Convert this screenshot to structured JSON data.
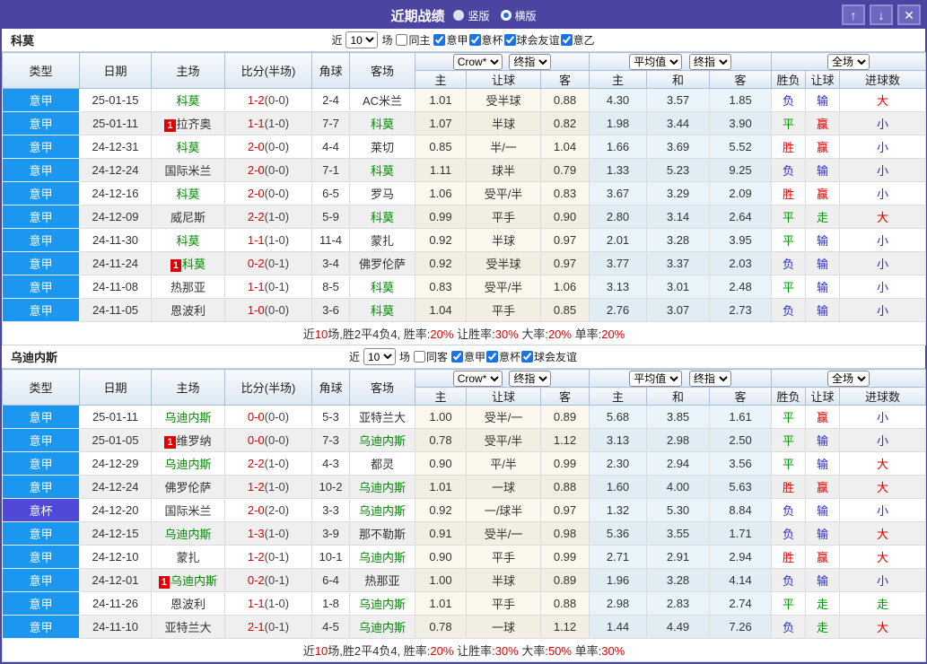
{
  "titlebar": {
    "title": "近期战绩",
    "radios": [
      {
        "label": "竖版",
        "selected": false
      },
      {
        "label": "横版",
        "selected": true
      }
    ],
    "up_icon": "↑",
    "down_icon": "↓",
    "close_icon": "✕"
  },
  "table_head": {
    "type": "类型",
    "date": "日期",
    "home": "主场",
    "score": "比分(半场)",
    "corner": "角球",
    "away": "客场",
    "odds_sub": [
      "主",
      "让球",
      "客"
    ],
    "avg_sub": [
      "主",
      "和",
      "客"
    ],
    "full_sub": [
      "胜负",
      "让球",
      "进球数"
    ]
  },
  "sections": [
    {
      "team": "科莫",
      "filter": {
        "prefix": "近",
        "count": "10",
        "suffix": "场",
        "same": "同主",
        "same_checked": false,
        "leagues": [
          "意甲",
          "意杯",
          "球会友谊",
          "意乙"
        ]
      },
      "selects": {
        "odds_src": "Crow*",
        "odds_kind": "终指",
        "avg_src": "平均值",
        "avg_kind": "终指",
        "scope": "全场"
      },
      "rows": [
        {
          "type": "意甲",
          "cup": false,
          "date": "25-01-15",
          "home": "科莫",
          "home_focus": true,
          "badge": null,
          "score": "1-2",
          "half": "(0-0)",
          "corner": "2-4",
          "away": "AC米兰",
          "away_focus": false,
          "odds": [
            "1.01",
            "受半球",
            "0.88"
          ],
          "avg": [
            "4.30",
            "3.57",
            "1.85"
          ],
          "result": [
            "负",
            "输",
            "大"
          ]
        },
        {
          "type": "意甲",
          "cup": false,
          "date": "25-01-11",
          "home": "拉齐奥",
          "home_focus": false,
          "badge": "1",
          "score": "1-1",
          "half": "(1-0)",
          "corner": "7-7",
          "away": "科莫",
          "away_focus": true,
          "odds": [
            "1.07",
            "半球",
            "0.82"
          ],
          "avg": [
            "1.98",
            "3.44",
            "3.90"
          ],
          "result": [
            "平",
            "赢",
            "小"
          ]
        },
        {
          "type": "意甲",
          "cup": false,
          "date": "24-12-31",
          "home": "科莫",
          "home_focus": true,
          "badge": null,
          "score": "2-0",
          "half": "(0-0)",
          "corner": "4-4",
          "away": "莱切",
          "away_focus": false,
          "odds": [
            "0.85",
            "半/一",
            "1.04"
          ],
          "avg": [
            "1.66",
            "3.69",
            "5.52"
          ],
          "result": [
            "胜",
            "赢",
            "小"
          ]
        },
        {
          "type": "意甲",
          "cup": false,
          "date": "24-12-24",
          "home": "国际米兰",
          "home_focus": false,
          "badge": null,
          "score": "2-0",
          "half": "(0-0)",
          "corner": "7-1",
          "away": "科莫",
          "away_focus": true,
          "odds": [
            "1.11",
            "球半",
            "0.79"
          ],
          "avg": [
            "1.33",
            "5.23",
            "9.25"
          ],
          "result": [
            "负",
            "输",
            "小"
          ]
        },
        {
          "type": "意甲",
          "cup": false,
          "date": "24-12-16",
          "home": "科莫",
          "home_focus": true,
          "badge": null,
          "score": "2-0",
          "half": "(0-0)",
          "corner": "6-5",
          "away": "罗马",
          "away_focus": false,
          "odds": [
            "1.06",
            "受平/半",
            "0.83"
          ],
          "avg": [
            "3.67",
            "3.29",
            "2.09"
          ],
          "result": [
            "胜",
            "赢",
            "小"
          ]
        },
        {
          "type": "意甲",
          "cup": false,
          "date": "24-12-09",
          "home": "威尼斯",
          "home_focus": false,
          "badge": null,
          "score": "2-2",
          "half": "(1-0)",
          "corner": "5-9",
          "away": "科莫",
          "away_focus": true,
          "odds": [
            "0.99",
            "平手",
            "0.90"
          ],
          "avg": [
            "2.80",
            "3.14",
            "2.64"
          ],
          "result": [
            "平",
            "走",
            "大"
          ]
        },
        {
          "type": "意甲",
          "cup": false,
          "date": "24-11-30",
          "home": "科莫",
          "home_focus": true,
          "badge": null,
          "score": "1-1",
          "half": "(1-0)",
          "corner": "11-4",
          "away": "蒙扎",
          "away_focus": false,
          "odds": [
            "0.92",
            "半球",
            "0.97"
          ],
          "avg": [
            "2.01",
            "3.28",
            "3.95"
          ],
          "result": [
            "平",
            "输",
            "小"
          ]
        },
        {
          "type": "意甲",
          "cup": false,
          "date": "24-11-24",
          "home": "科莫",
          "home_focus": true,
          "badge": "1",
          "score": "0-2",
          "half": "(0-1)",
          "corner": "3-4",
          "away": "佛罗伦萨",
          "away_focus": false,
          "odds": [
            "0.92",
            "受半球",
            "0.97"
          ],
          "avg": [
            "3.77",
            "3.37",
            "2.03"
          ],
          "result": [
            "负",
            "输",
            "小"
          ]
        },
        {
          "type": "意甲",
          "cup": false,
          "date": "24-11-08",
          "home": "热那亚",
          "home_focus": false,
          "badge": null,
          "score": "1-1",
          "half": "(0-1)",
          "corner": "8-5",
          "away": "科莫",
          "away_focus": true,
          "odds": [
            "0.83",
            "受平/半",
            "1.06"
          ],
          "avg": [
            "3.13",
            "3.01",
            "2.48"
          ],
          "result": [
            "平",
            "输",
            "小"
          ]
        },
        {
          "type": "意甲",
          "cup": false,
          "date": "24-11-05",
          "home": "恩波利",
          "home_focus": false,
          "badge": null,
          "score": "1-0",
          "half": "(0-0)",
          "corner": "3-6",
          "away": "科莫",
          "away_focus": true,
          "odds": [
            "1.04",
            "平手",
            "0.85"
          ],
          "avg": [
            "2.76",
            "3.07",
            "2.73"
          ],
          "result": [
            "负",
            "输",
            "小"
          ]
        }
      ],
      "summary": [
        {
          "t": "近"
        },
        {
          "t": "10",
          "red": true
        },
        {
          "t": "场,胜2平4负4, 胜率:"
        },
        {
          "t": "20%",
          "red": true
        },
        {
          "t": " 让胜率:"
        },
        {
          "t": "30%",
          "red": true
        },
        {
          "t": " 大率:"
        },
        {
          "t": "20%",
          "red": true
        },
        {
          "t": " 单率:"
        },
        {
          "t": "20%",
          "red": true
        }
      ]
    },
    {
      "team": "乌迪内斯",
      "filter": {
        "prefix": "近",
        "count": "10",
        "suffix": "场",
        "same": "同客",
        "same_checked": false,
        "leagues": [
          "意甲",
          "意杯",
          "球会友谊"
        ]
      },
      "selects": {
        "odds_src": "Crow*",
        "odds_kind": "终指",
        "avg_src": "平均值",
        "avg_kind": "终指",
        "scope": "全场"
      },
      "rows": [
        {
          "type": "意甲",
          "cup": false,
          "date": "25-01-11",
          "home": "乌迪内斯",
          "home_focus": true,
          "badge": null,
          "score": "0-0",
          "half": "(0-0)",
          "corner": "5-3",
          "away": "亚特兰大",
          "away_focus": false,
          "odds": [
            "1.00",
            "受半/一",
            "0.89"
          ],
          "avg": [
            "5.68",
            "3.85",
            "1.61"
          ],
          "result": [
            "平",
            "赢",
            "小"
          ]
        },
        {
          "type": "意甲",
          "cup": false,
          "date": "25-01-05",
          "home": "维罗纳",
          "home_focus": false,
          "badge": "1",
          "score": "0-0",
          "half": "(0-0)",
          "corner": "7-3",
          "away": "乌迪内斯",
          "away_focus": true,
          "odds": [
            "0.78",
            "受平/半",
            "1.12"
          ],
          "avg": [
            "3.13",
            "2.98",
            "2.50"
          ],
          "result": [
            "平",
            "输",
            "小"
          ]
        },
        {
          "type": "意甲",
          "cup": false,
          "date": "24-12-29",
          "home": "乌迪内斯",
          "home_focus": true,
          "badge": null,
          "score": "2-2",
          "half": "(1-0)",
          "corner": "4-3",
          "away": "都灵",
          "away_focus": false,
          "odds": [
            "0.90",
            "平/半",
            "0.99"
          ],
          "avg": [
            "2.30",
            "2.94",
            "3.56"
          ],
          "result": [
            "平",
            "输",
            "大"
          ]
        },
        {
          "type": "意甲",
          "cup": false,
          "date": "24-12-24",
          "home": "佛罗伦萨",
          "home_focus": false,
          "badge": null,
          "score": "1-2",
          "half": "(1-0)",
          "corner": "10-2",
          "away": "乌迪内斯",
          "away_focus": true,
          "odds": [
            "1.01",
            "一球",
            "0.88"
          ],
          "avg": [
            "1.60",
            "4.00",
            "5.63"
          ],
          "result": [
            "胜",
            "赢",
            "大"
          ]
        },
        {
          "type": "意杯",
          "cup": true,
          "date": "24-12-20",
          "home": "国际米兰",
          "home_focus": false,
          "badge": null,
          "score": "2-0",
          "half": "(2-0)",
          "corner": "3-3",
          "away": "乌迪内斯",
          "away_focus": true,
          "odds": [
            "0.92",
            "一/球半",
            "0.97"
          ],
          "avg": [
            "1.32",
            "5.30",
            "8.84"
          ],
          "result": [
            "负",
            "输",
            "小"
          ]
        },
        {
          "type": "意甲",
          "cup": false,
          "date": "24-12-15",
          "home": "乌迪内斯",
          "home_focus": true,
          "badge": null,
          "score": "1-3",
          "half": "(1-0)",
          "corner": "3-9",
          "away": "那不勒斯",
          "away_focus": false,
          "odds": [
            "0.91",
            "受半/一",
            "0.98"
          ],
          "avg": [
            "5.36",
            "3.55",
            "1.71"
          ],
          "result": [
            "负",
            "输",
            "大"
          ]
        },
        {
          "type": "意甲",
          "cup": false,
          "date": "24-12-10",
          "home": "蒙扎",
          "home_focus": false,
          "badge": null,
          "score": "1-2",
          "half": "(0-1)",
          "corner": "10-1",
          "away": "乌迪内斯",
          "away_focus": true,
          "odds": [
            "0.90",
            "平手",
            "0.99"
          ],
          "avg": [
            "2.71",
            "2.91",
            "2.94"
          ],
          "result": [
            "胜",
            "赢",
            "大"
          ]
        },
        {
          "type": "意甲",
          "cup": false,
          "date": "24-12-01",
          "home": "乌迪内斯",
          "home_focus": true,
          "badge": "1",
          "score": "0-2",
          "half": "(0-1)",
          "corner": "6-4",
          "away": "热那亚",
          "away_focus": false,
          "odds": [
            "1.00",
            "半球",
            "0.89"
          ],
          "avg": [
            "1.96",
            "3.28",
            "4.14"
          ],
          "result": [
            "负",
            "输",
            "小"
          ]
        },
        {
          "type": "意甲",
          "cup": false,
          "date": "24-11-26",
          "home": "恩波利",
          "home_focus": false,
          "badge": null,
          "score": "1-1",
          "half": "(1-0)",
          "corner": "1-8",
          "away": "乌迪内斯",
          "away_focus": true,
          "odds": [
            "1.01",
            "平手",
            "0.88"
          ],
          "avg": [
            "2.98",
            "2.83",
            "2.74"
          ],
          "result": [
            "平",
            "走",
            "走"
          ]
        },
        {
          "type": "意甲",
          "cup": false,
          "date": "24-11-10",
          "home": "亚特兰大",
          "home_focus": false,
          "badge": null,
          "score": "2-1",
          "half": "(0-1)",
          "corner": "4-5",
          "away": "乌迪内斯",
          "away_focus": true,
          "odds": [
            "0.78",
            "一球",
            "1.12"
          ],
          "avg": [
            "1.44",
            "4.49",
            "7.26"
          ],
          "result": [
            "负",
            "走",
            "大"
          ]
        }
      ],
      "summary": [
        {
          "t": "近"
        },
        {
          "t": "10",
          "red": true
        },
        {
          "t": "场,胜2平4负4, 胜率:"
        },
        {
          "t": "20%",
          "red": true
        },
        {
          "t": " 让胜率:"
        },
        {
          "t": "30%",
          "red": true
        },
        {
          "t": " 大率:"
        },
        {
          "t": "50%",
          "red": true
        },
        {
          "t": " 单率:"
        },
        {
          "t": "30%",
          "red": true
        }
      ]
    }
  ],
  "colors": {
    "titlebar_purple": "#4b45a1",
    "league_blue": "#1b97f0",
    "cup_purple": "#4f48d8",
    "focus_team_green": "#008800",
    "win_red": "#dd0000",
    "draw_green": "#009900",
    "lose_blue": "#2b2bd5"
  }
}
